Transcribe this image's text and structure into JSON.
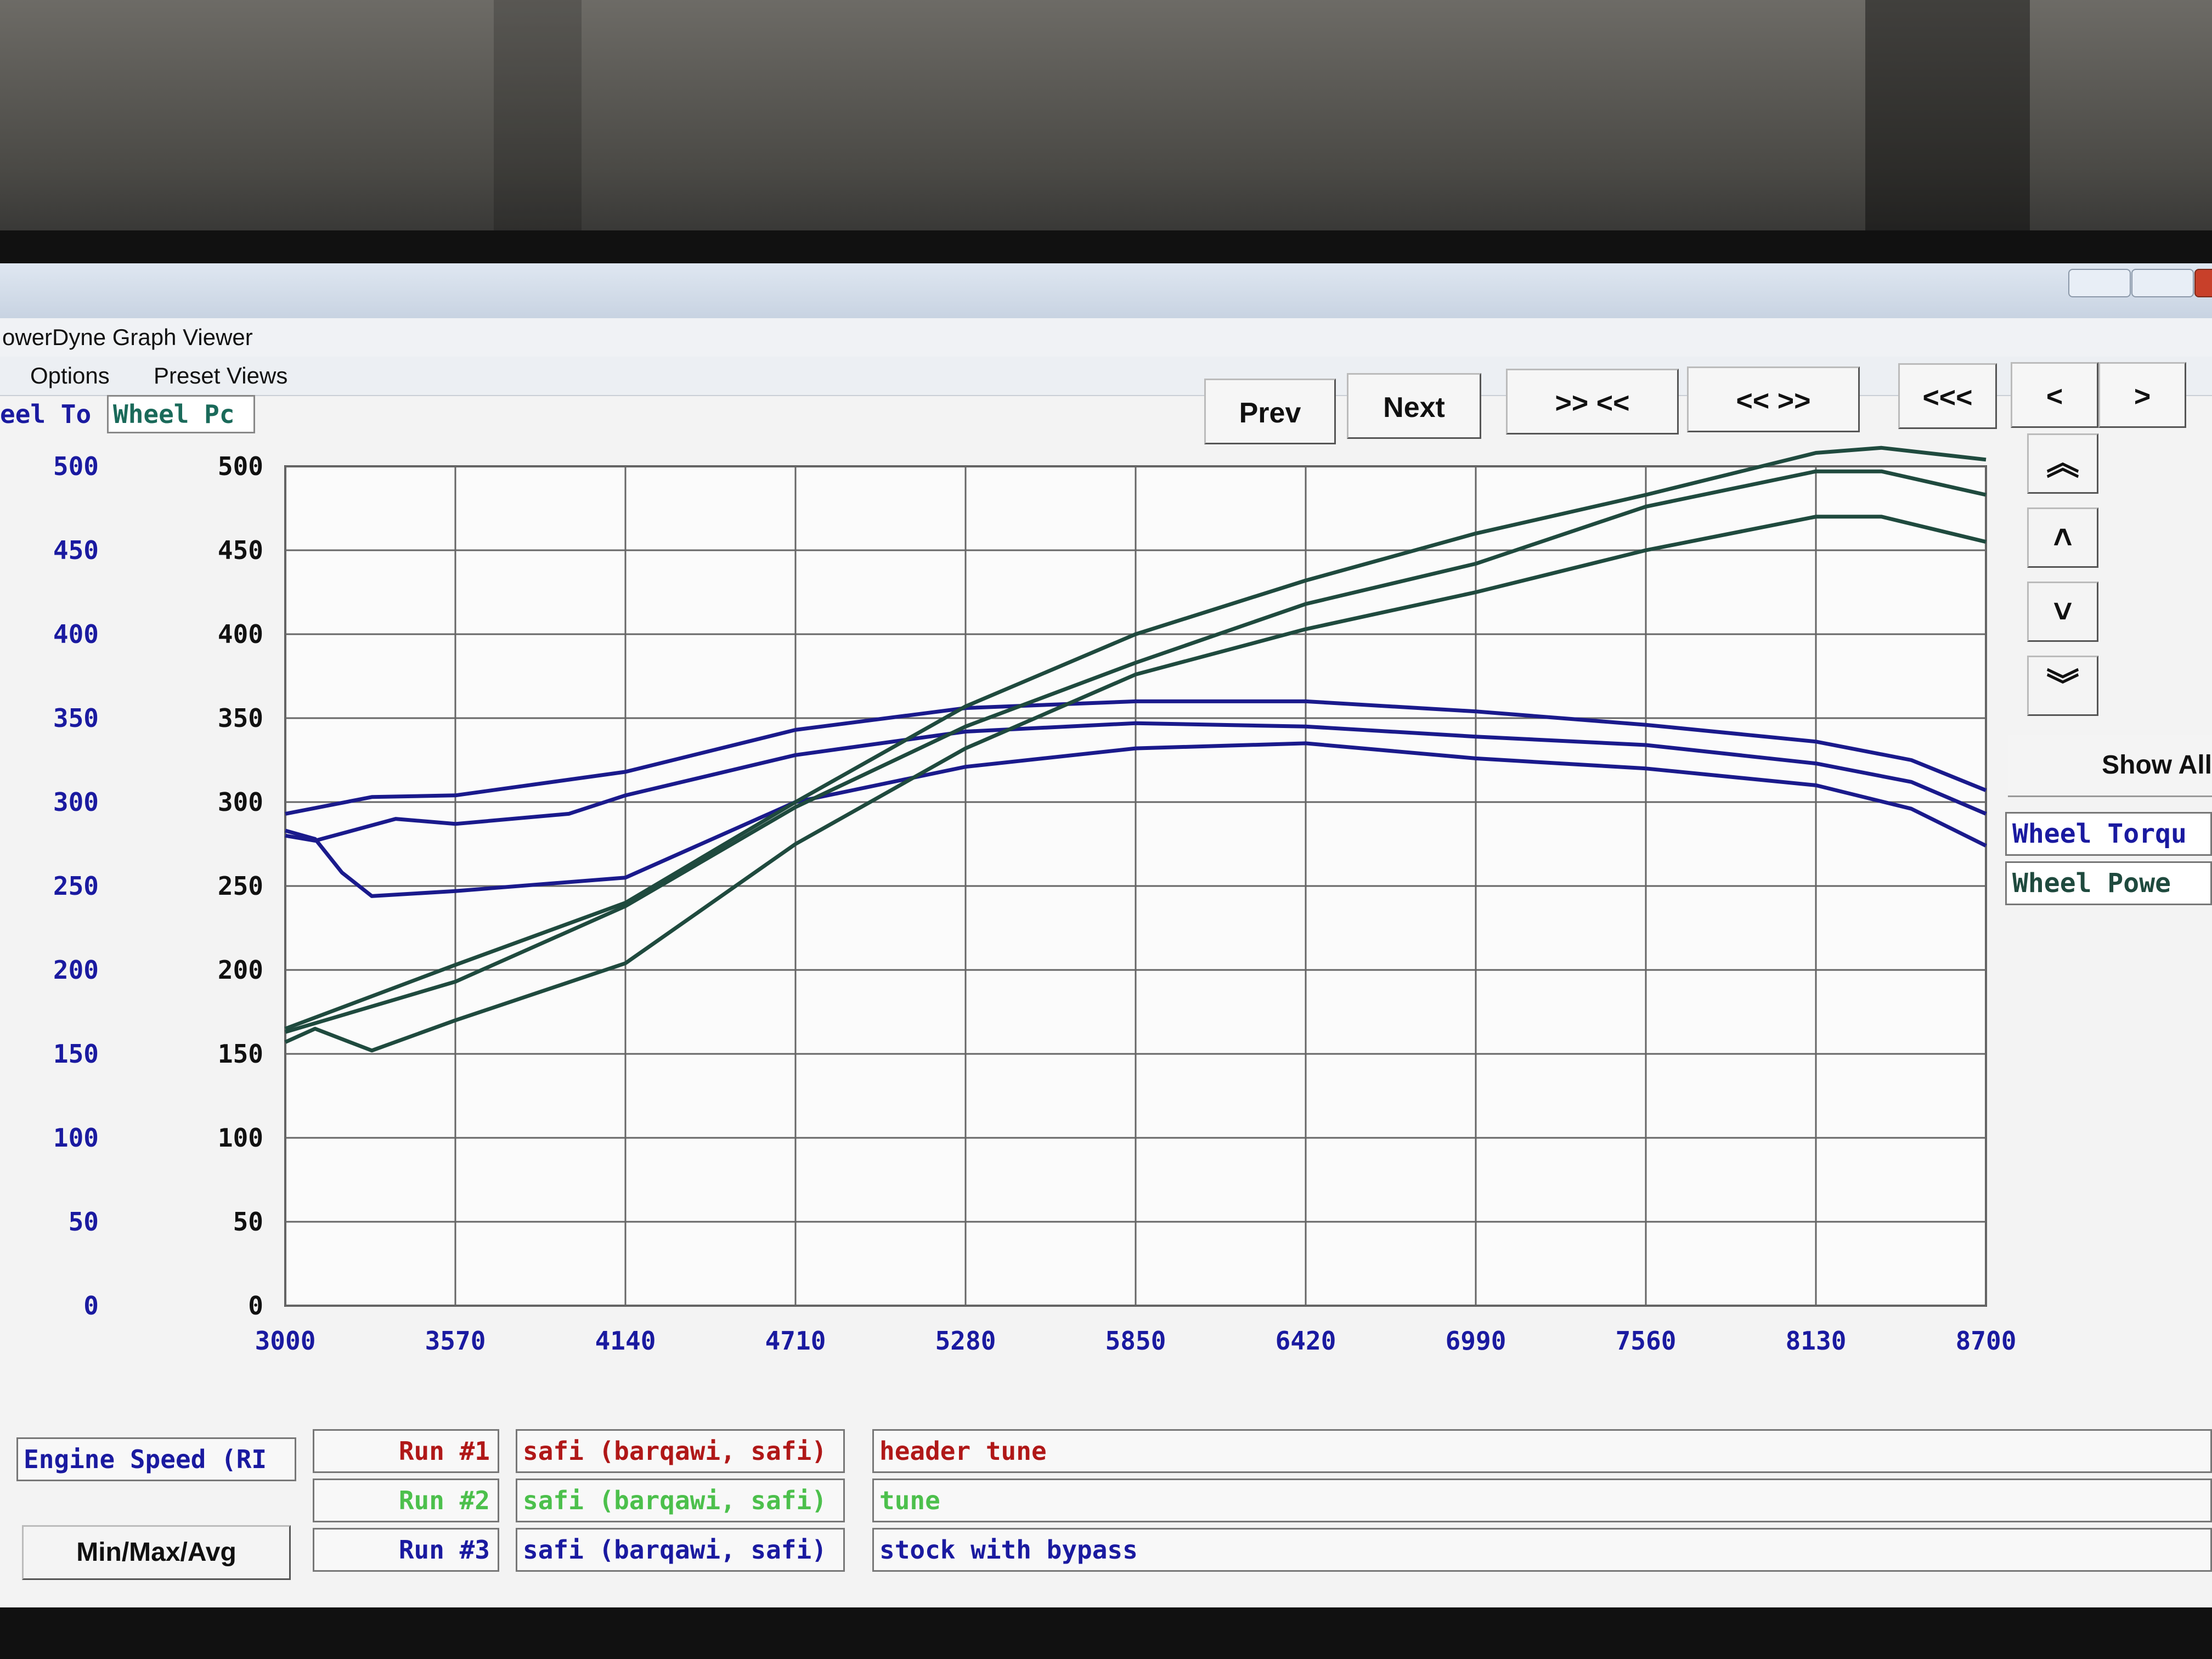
{
  "window": {
    "title": "owerDyne Graph Viewer"
  },
  "menu": {
    "options": "Options",
    "preset_views": "Preset Views"
  },
  "tabs": {
    "left_axis": "eel To",
    "right_axis": "Wheel Pc"
  },
  "toolbar": {
    "prev": "Prev",
    "next": "Next",
    "zoom_in": ">> <<",
    "zoom_out": "<< >>",
    "rewind": "<<<",
    "left": "<",
    "right": ">"
  },
  "side": {
    "show_all": "Show All",
    "legend": [
      "Wheel Torqu",
      "Wheel Powe"
    ]
  },
  "bottom": {
    "x_channel": "Engine Speed (RI",
    "min_max_avg": "Min/Max/Avg",
    "runs": [
      {
        "label": "Run #1",
        "driver": "safi (barqawi, safi)",
        "note": "header tune",
        "color": "#b01818"
      },
      {
        "label": "Run #2",
        "driver": "safi (barqawi, safi)",
        "note": "tune",
        "color": "#4cc04c"
      },
      {
        "label": "Run #3",
        "driver": "safi (barqawi, safi)",
        "note": "stock with bypass",
        "color": "#1a1aa0"
      }
    ]
  },
  "colors": {
    "torque": "#1a1a8c",
    "power": "#1f4a3e",
    "grid": "#666666",
    "left_ticks": "#1a1aa0",
    "right_ticks": "#111111"
  },
  "chart_data": {
    "type": "line",
    "x_ticks": [
      3000,
      3570,
      4140,
      4710,
      5280,
      5850,
      6420,
      6990,
      7560,
      8130,
      8700
    ],
    "y_ticks_left": [
      0,
      50,
      100,
      150,
      200,
      250,
      300,
      350,
      400,
      450,
      500
    ],
    "y_ticks_right": [
      0,
      50,
      100,
      150,
      200,
      250,
      300,
      350,
      400,
      450,
      500
    ],
    "y_tick_labels_left": [
      "0",
      "50",
      "100",
      "150",
      "200",
      "250",
      "300",
      "350",
      "400",
      "450",
      "500"
    ],
    "xlim": [
      3000,
      8700
    ],
    "ylim": [
      0,
      500
    ],
    "grid": true,
    "series": [
      {
        "kind": "torque",
        "x": [
          3000,
          3290,
          3570,
          4140,
          4710,
          5280,
          5850,
          6420,
          6990,
          7560,
          8130,
          8450,
          8700
        ],
        "y": [
          293,
          303,
          304,
          318,
          343,
          356,
          360,
          360,
          354,
          346,
          336,
          325,
          307
        ]
      },
      {
        "kind": "torque",
        "x": [
          3000,
          3100,
          3370,
          3570,
          3950,
          4140,
          4710,
          5280,
          5850,
          6420,
          6990,
          7560,
          8130,
          8450,
          8700
        ],
        "y": [
          280,
          277,
          290,
          287,
          293,
          304,
          328,
          342,
          347,
          345,
          339,
          334,
          323,
          312,
          293
        ]
      },
      {
        "kind": "torque",
        "x": [
          3000,
          3100,
          3190,
          3290,
          3570,
          4140,
          4710,
          5280,
          5850,
          6420,
          6990,
          7560,
          8130,
          8450,
          8700
        ],
        "y": [
          283,
          278,
          258,
          244,
          247,
          255,
          300,
          321,
          332,
          335,
          326,
          320,
          310,
          296,
          274
        ]
      },
      {
        "kind": "power",
        "x": [
          3000,
          3570,
          4140,
          4710,
          5280,
          5850,
          6420,
          6990,
          7560,
          8130,
          8350,
          8700
        ],
        "y": [
          165,
          203,
          240,
          300,
          357,
          400,
          432,
          460,
          483,
          508,
          511,
          504
        ]
      },
      {
        "kind": "power",
        "x": [
          3000,
          3570,
          4140,
          4710,
          5280,
          5850,
          6420,
          6990,
          7560,
          8130,
          8350,
          8700
        ],
        "y": [
          163,
          193,
          238,
          297,
          345,
          383,
          418,
          442,
          476,
          497,
          497,
          483
        ]
      },
      {
        "kind": "power",
        "x": [
          3000,
          3100,
          3290,
          3570,
          4140,
          4710,
          5280,
          5850,
          6420,
          6990,
          7560,
          8130,
          8350,
          8700
        ],
        "y": [
          157,
          165,
          152,
          170,
          204,
          275,
          332,
          376,
          403,
          425,
          450,
          470,
          470,
          455
        ]
      }
    ]
  }
}
